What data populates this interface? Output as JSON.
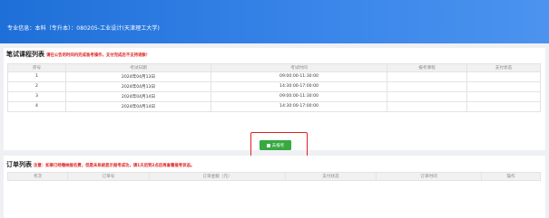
{
  "banner": {
    "text": "专业信息：本科（专升本）：080205-工业设计(天津理工大学)",
    "color_start": "#1e6fd8",
    "color_end": "#4b93ee"
  },
  "exam_section": {
    "title": "笔试课程列表",
    "note": "请在公告的时间内完成准考操作，支付完成后不支持退款！",
    "columns": [
      "序号",
      "考试日期",
      "考试时间",
      "报考课程",
      "支付状态"
    ],
    "rows": [
      [
        "1",
        "2024年04月13日",
        "09:00:00-11:30:00",
        "",
        ""
      ],
      [
        "2",
        "2024年04月13日",
        "14:30:00-17:00:00",
        "",
        ""
      ],
      [
        "3",
        "2024年04月14日",
        "09:00:00-11:30:00",
        "",
        ""
      ],
      [
        "4",
        "2024年04月14日",
        "14:30:00-17:00:00",
        "",
        ""
      ]
    ]
  },
  "action": {
    "button_label": "去报考",
    "button_icon": "register-icon",
    "button_color": "#36a940",
    "highlight_color": "#e02020"
  },
  "order_section": {
    "title": "订单列表",
    "note": "注意：如果已经缴纳报名费，但是未系统显示报考成功，请1天后到2点后再查看报考状态。",
    "columns": [
      "考次",
      "订单号",
      "订单金额（元）",
      "支付状态",
      "订单时间",
      "操作"
    ]
  }
}
